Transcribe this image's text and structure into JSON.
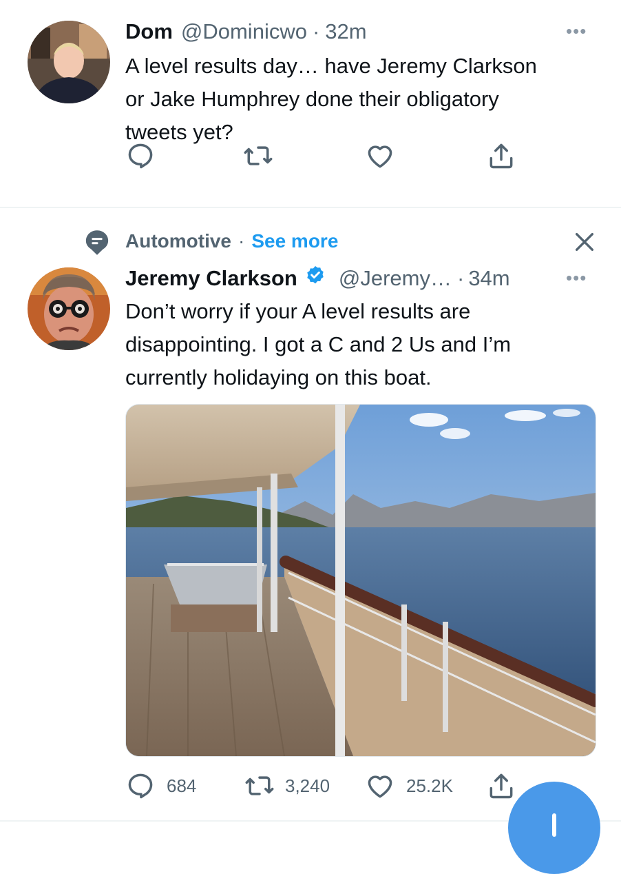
{
  "tweet1": {
    "display_name": "Dom",
    "handle": "@Dominicwo",
    "separator": "·",
    "time": "32m",
    "text_lines": [
      "A level results day… have Jeremy Clarkson",
      "or Jake Humphrey done their obligatory",
      "tweets yet?"
    ],
    "actions": {
      "reply_icon": "reply-icon",
      "retweet_icon": "retweet-icon",
      "like_icon": "heart-icon",
      "share_icon": "share-icon"
    }
  },
  "tweet2": {
    "topic": {
      "icon": "topic-icon",
      "name": "Automotive",
      "separator": "·",
      "see_more": "See more",
      "close_icon": "close-icon"
    },
    "display_name": "Jeremy Clarkson",
    "verified_icon": "verified-badge-icon",
    "handle": "@Jeremy…",
    "separator": "·",
    "time": "34m",
    "text_lines": [
      "Don’t worry if your A level results are",
      "disappointing. I got a C and 2 Us and I’m",
      "currently holidaying on this boat."
    ],
    "media": "boat-deck-photo",
    "actions": {
      "replies": "684",
      "retweets": "3,240",
      "likes": "25.2K"
    }
  },
  "fab_icon": "compose-plus-icon",
  "colors": {
    "accent": "#1d9bf0",
    "muted": "#536471",
    "text": "#0f1419",
    "fab": "#4a99e9"
  }
}
